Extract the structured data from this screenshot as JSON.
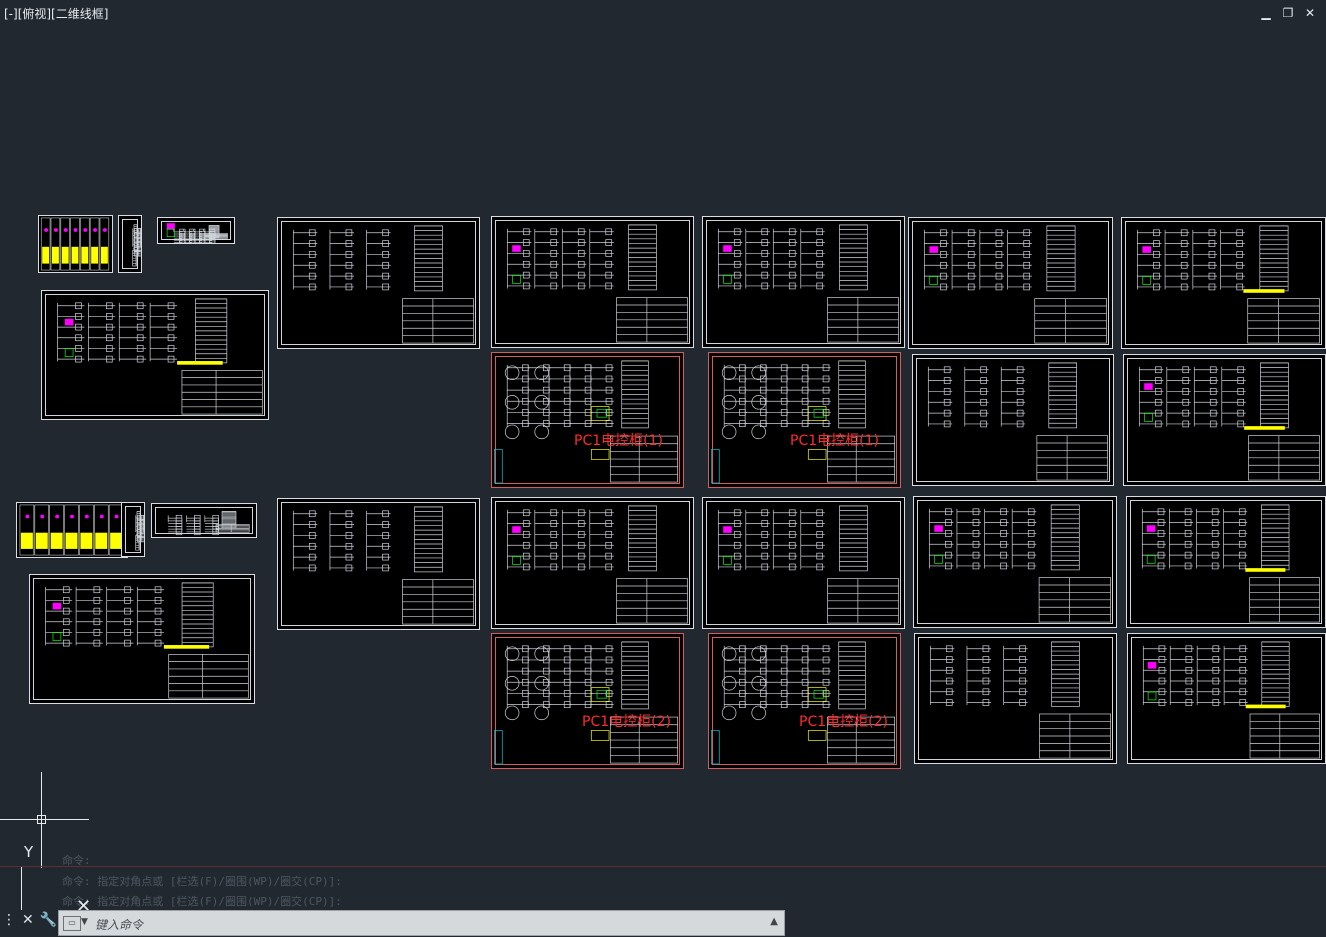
{
  "viewport": {
    "label": "[-][俯视][二维线框]"
  },
  "window_controls": {
    "minimize": "▁",
    "restore": "❐",
    "close": "✕"
  },
  "plate_labels": {
    "p1": "PC1电控柜(1)",
    "p2": "PC1电控柜(1)",
    "p3": "PC1电控柜(2)",
    "p4": "PC1电控柜(2)"
  },
  "command": {
    "history": [
      "命令:",
      "命令: 指定对角点或 [栏选(F)/圈围(WP)/圈交(CP)]:",
      "命令: 指定对角点或 [栏选(F)/圈围(WP)/圈交(CP)]:"
    ],
    "placeholder": "键入命令"
  },
  "ucs": {
    "y_label": "Y"
  },
  "colors": {
    "background": "#212830",
    "sheet_border": "#d8dde3",
    "plate_red": "#ff2a2a",
    "magenta": "#ff00ff",
    "yellow": "#ffff00",
    "green": "#00ff00"
  }
}
